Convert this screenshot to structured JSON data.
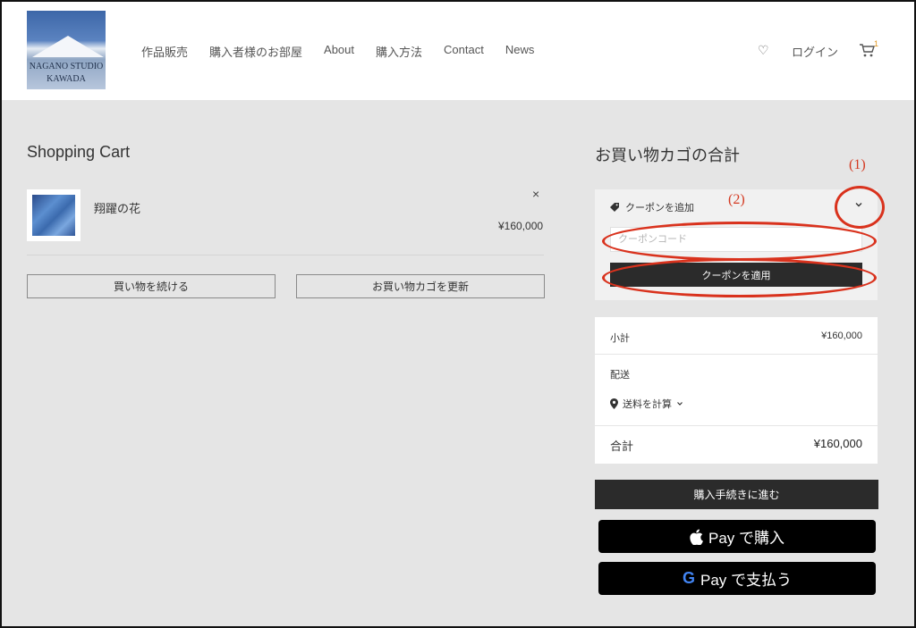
{
  "header": {
    "logo_line1": "NAGANO STUDIO",
    "logo_line2": "KAWADA",
    "nav": [
      "作品販売",
      "購入者様のお部屋",
      "About",
      "購入方法",
      "Contact",
      "News"
    ],
    "wishlist_icon": "heart-icon",
    "login_label": "ログイン",
    "cart_icon": "cart-icon",
    "cart_count": "1"
  },
  "cart": {
    "title": "Shopping Cart",
    "item_name": "翔躍の花",
    "item_price": "¥160,000",
    "remove_glyph": "×",
    "continue_label": "買い物を続ける",
    "update_label": "お買い物カゴを更新"
  },
  "totals": {
    "title": "お買い物カゴの合計",
    "coupon_toggle_label": "クーポンを追加",
    "coupon_placeholder": "クーポンコード",
    "coupon_apply_label": "クーポンを適用",
    "subtotal_label": "小計",
    "subtotal_value": "¥160,000",
    "shipping_label": "配送",
    "shipping_calc_label": "送料を計算",
    "total_label": "合計",
    "total_value": "¥160,000",
    "checkout_label": "購入手続きに進む",
    "apple_pay_label": "Pay で購入",
    "google_pay_label": "Pay で支払う"
  },
  "annotations": {
    "label1": "(1)",
    "label2": "(2)"
  },
  "colors": {
    "annotation": "#d9321d",
    "dark_button": "#2b2b2b",
    "badge": "#e0961f"
  }
}
